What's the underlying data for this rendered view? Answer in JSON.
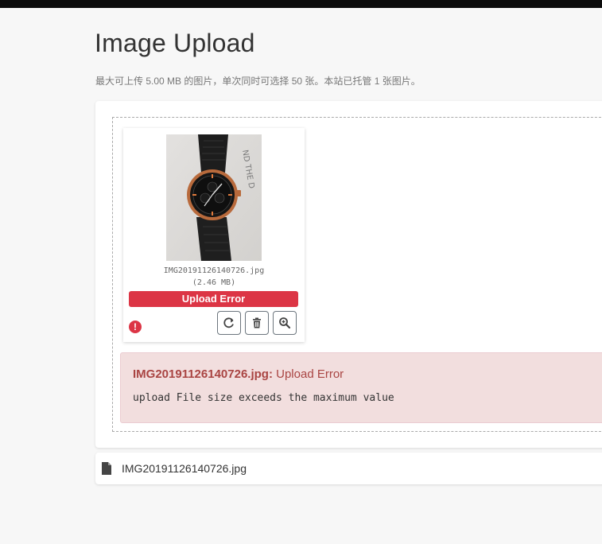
{
  "page": {
    "title": "Image Upload",
    "subtitle": "最大可上传 5.00 MB 的图片，单次同时可选择 50 张。本站已托管 1 张图片。"
  },
  "preview": {
    "file_name": "IMG20191126140726.jpg",
    "file_size": "(2.46 MB)",
    "status_label": "Upload Error",
    "error_indicator": "!",
    "actions": [
      {
        "name": "retry",
        "icon": "refresh-icon"
      },
      {
        "name": "delete",
        "icon": "trash-icon"
      },
      {
        "name": "zoom",
        "icon": "zoom-in-icon"
      }
    ]
  },
  "alert": {
    "file_name": "IMG20191126140726.jpg:",
    "title_suffix": "Upload Error",
    "message": "upload File size exceeds the maximum value"
  },
  "caption": {
    "icon": "file-icon",
    "text": "IMG20191126140726.jpg"
  },
  "colors": {
    "error": "#dc3545",
    "alert_bg": "#f2dede",
    "alert_text": "#a94442"
  }
}
